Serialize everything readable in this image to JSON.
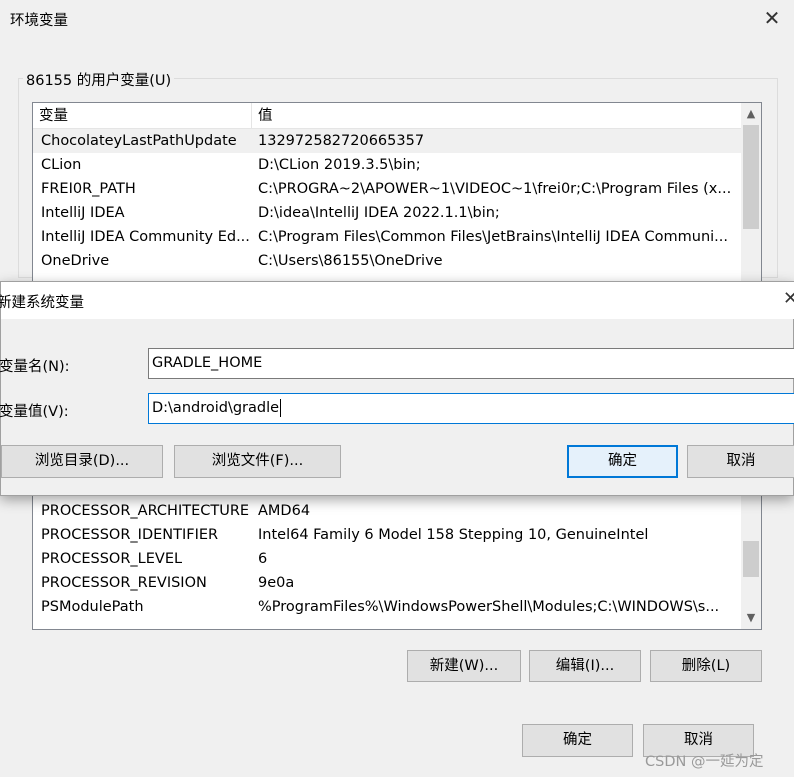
{
  "window": {
    "title": "环境变量",
    "close_glyph": "✕"
  },
  "user_vars": {
    "group_label": "86155 的用户变量(U)",
    "columns": [
      "变量",
      "值"
    ],
    "rows": [
      {
        "name": "ChocolateyLastPathUpdate",
        "value": "132972582720665357"
      },
      {
        "name": "CLion",
        "value": "D:\\CLion 2019.3.5\\bin;"
      },
      {
        "name": "FREI0R_PATH",
        "value": "C:\\PROGRA~2\\APOWER~1\\VIDEOC~1\\frei0r;C:\\Program Files (x..."
      },
      {
        "name": "IntelliJ IDEA",
        "value": "D:\\idea\\IntelliJ IDEA 2022.1.1\\bin;"
      },
      {
        "name": "IntelliJ IDEA Community Ed...",
        "value": "C:\\Program Files\\Common Files\\JetBrains\\IntelliJ IDEA Communi..."
      },
      {
        "name": "OneDrive",
        "value": "C:\\Users\\86155\\OneDrive"
      }
    ]
  },
  "system_vars": {
    "rows": [
      {
        "name": "PROCESSOR_ARCHITECTURE",
        "value": "AMD64"
      },
      {
        "name": "PROCESSOR_IDENTIFIER",
        "value": "Intel64 Family 6 Model 158 Stepping 10, GenuineIntel"
      },
      {
        "name": "PROCESSOR_LEVEL",
        "value": "6"
      },
      {
        "name": "PROCESSOR_REVISION",
        "value": "9e0a"
      },
      {
        "name": "PSModulePath",
        "value": "%ProgramFiles%\\WindowsPowerShell\\Modules;C:\\WINDOWS\\s..."
      }
    ],
    "buttons": {
      "new": "新建(W)...",
      "edit": "编辑(I)...",
      "delete": "删除(L)"
    }
  },
  "footer": {
    "ok": "确定",
    "cancel": "取消"
  },
  "dialog": {
    "title": "新建系统变量",
    "name_label": "变量名(N):",
    "name_value": "GRADLE_HOME",
    "value_label": "变量值(V):",
    "value_value": "D:\\android\\gradle",
    "browse_dir": "浏览目录(D)...",
    "browse_file": "浏览文件(F)...",
    "ok": "确定",
    "cancel": "取消",
    "close_glyph": "✕"
  },
  "watermark": "CSDN @一延为定"
}
